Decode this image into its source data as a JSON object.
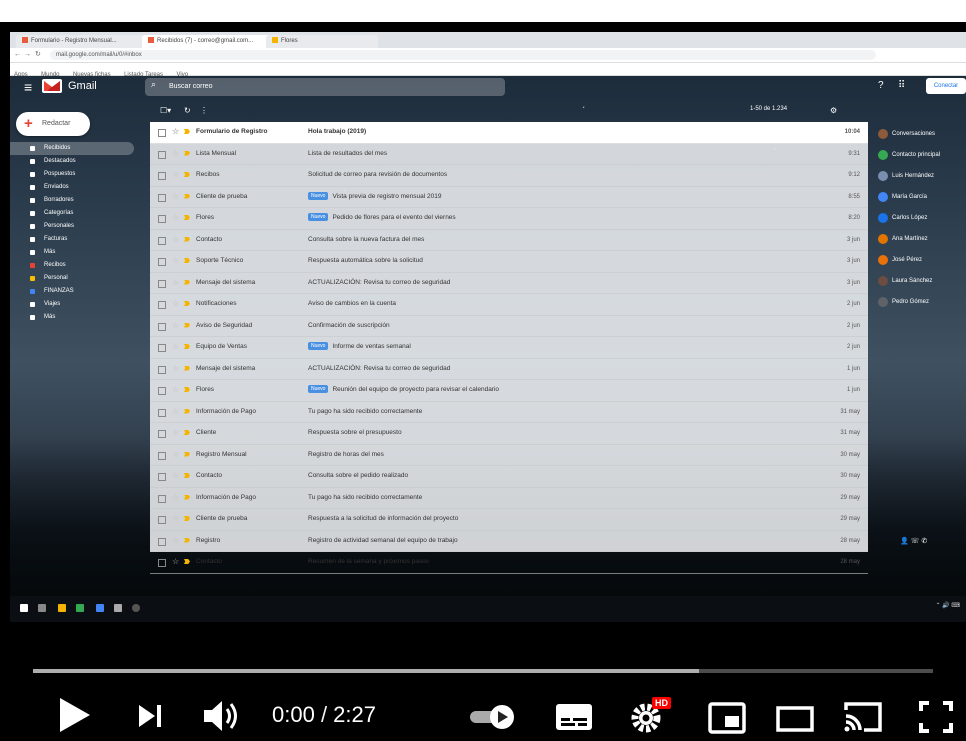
{
  "browser": {
    "tabs": [
      "Formulario - Registro Mensual...",
      "Recibidos (7) - correo@gmail.com...",
      "Flores"
    ],
    "url": "mail.google.com/mail/u/0/#inbox",
    "bookmarks": [
      "Apps",
      "Mundo",
      "Nuevas fichas",
      "Listado Tareas",
      "Vivo"
    ]
  },
  "gmail": {
    "app_name": "Gmail",
    "search_placeholder": "Buscar correo",
    "account_button": "Conectar",
    "compose_label": "Redactar",
    "nav": [
      "Recibidos",
      "Destacados",
      "Pospuestos",
      "Enviados",
      "Borradores",
      "Categorías",
      "Personales",
      "Facturas",
      "Más",
      "Recibos",
      "Personal",
      "FINANZAS",
      "Viajes",
      "Más"
    ],
    "pager": "1-50 de 1.234",
    "emails": [
      {
        "sender": "Formulario de Registro",
        "subject": "Hola trabajo (2019)",
        "date": "10:04",
        "label": ""
      },
      {
        "sender": "Lista Mensual",
        "subject": "Lista de resultados del mes",
        "date": "9:31",
        "label": ""
      },
      {
        "sender": "Recibos",
        "subject": "Solicitud de correo para revisión de documentos",
        "date": "9:12",
        "label": ""
      },
      {
        "sender": "Cliente de prueba",
        "subject": "Vista previa de registro mensual 2019",
        "date": "8:55",
        "label": "Nuevo"
      },
      {
        "sender": "Flores",
        "subject": "Pedido de flores para el evento del viernes",
        "date": "8:20",
        "label": "Nuevo"
      },
      {
        "sender": "Contacto",
        "subject": "Consulta sobre la nueva factura del mes",
        "date": "3 jun",
        "label": ""
      },
      {
        "sender": "Soporte Técnico",
        "subject": "Respuesta automática sobre la solicitud",
        "date": "3 jun",
        "label": ""
      },
      {
        "sender": "Mensaje del sistema",
        "subject": "ACTUALIZACIÓN: Revisa tu correo de seguridad",
        "date": "3 jun",
        "label": ""
      },
      {
        "sender": "Notificaciones",
        "subject": "Aviso de cambios en la cuenta",
        "date": "2 jun",
        "label": ""
      },
      {
        "sender": "Aviso de Seguridad",
        "subject": "Confirmación de suscripción",
        "date": "2 jun",
        "label": ""
      },
      {
        "sender": "Equipo de Ventas",
        "subject": "Informe de ventas semanal",
        "date": "2 jun",
        "label": "Nuevo"
      },
      {
        "sender": "Mensaje del sistema",
        "subject": "ACTUALIZACIÓN: Revisa tu correo de seguridad",
        "date": "1 jun",
        "label": ""
      },
      {
        "sender": "Flores",
        "subject": "Reunión del equipo de proyecto para revisar el calendario",
        "date": "1 jun",
        "label": "Nuevo"
      },
      {
        "sender": "Información de Pago",
        "subject": "Tu pago ha sido recibido correctamente",
        "date": "31 may",
        "label": ""
      },
      {
        "sender": "Cliente",
        "subject": "Respuesta sobre el presupuesto",
        "date": "31 may",
        "label": ""
      },
      {
        "sender": "Registro Mensual",
        "subject": "Registro de horas del mes",
        "date": "30 may",
        "label": ""
      },
      {
        "sender": "Contacto",
        "subject": "Consulta sobre el pedido realizado",
        "date": "30 may",
        "label": ""
      },
      {
        "sender": "Información de Pago",
        "subject": "Tu pago ha sido recibido correctamente",
        "date": "29 may",
        "label": ""
      },
      {
        "sender": "Cliente de prueba",
        "subject": "Respuesta a la solicitud de información del proyecto",
        "date": "29 may",
        "label": ""
      },
      {
        "sender": "Registro",
        "subject": "Registro de actividad semanal del equipo de trabajo",
        "date": "28 may",
        "label": ""
      },
      {
        "sender": "Contacto",
        "subject": "Resumen de la semana y próximos pasos",
        "date": "28 may",
        "label": ""
      }
    ],
    "chat": [
      "Conversaciones",
      "Contacto principal",
      "Luis Hernández",
      "María García",
      "Carlos López",
      "Ana Martínez",
      "José Pérez",
      "Laura Sánchez",
      "Pedro Gómez"
    ]
  },
  "player": {
    "current_time": "0:00",
    "time_separator": " / ",
    "duration": "2:27",
    "buffered_fraction": 0.74,
    "played_fraction": 0.0,
    "hd_badge": "HD",
    "accent_color": "#ff0000"
  }
}
